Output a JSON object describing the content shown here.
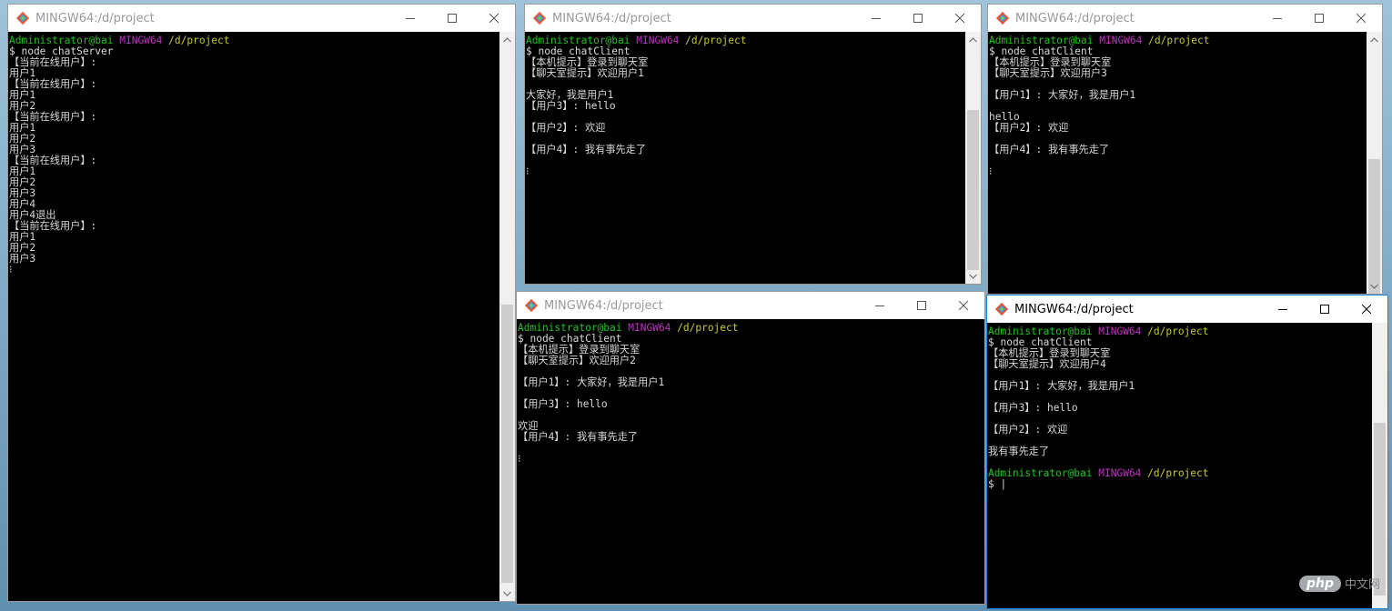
{
  "windows": {
    "server": {
      "title": "MINGW64:/d/project",
      "lines": [
        {
          "segments": [
            {
              "text": "Administrator@bai ",
              "c": "g"
            },
            {
              "text": "MINGW64 ",
              "c": "m"
            },
            {
              "text": "/d/project",
              "c": "y"
            }
          ]
        },
        {
          "text": "$ node chatServer"
        },
        {
          "text": "【当前在线用户】:"
        },
        {
          "text": "用户1"
        },
        {
          "text": "【当前在线用户】:"
        },
        {
          "text": "用户1"
        },
        {
          "text": "用户2"
        },
        {
          "text": "【当前在线用户】:"
        },
        {
          "text": "用户1"
        },
        {
          "text": "用户2"
        },
        {
          "text": "用户3"
        },
        {
          "text": "【当前在线用户】:"
        },
        {
          "text": "用户1"
        },
        {
          "text": "用户2"
        },
        {
          "text": "用户3"
        },
        {
          "text": "用户4"
        },
        {
          "text": "用户4退出"
        },
        {
          "text": "【当前在线用户】:"
        },
        {
          "text": "用户1"
        },
        {
          "text": "用户2"
        },
        {
          "text": "用户3"
        },
        {
          "text": "⁝"
        }
      ]
    },
    "client1": {
      "title": "MINGW64:/d/project",
      "lines": [
        {
          "segments": [
            {
              "text": "Administrator@bai ",
              "c": "g"
            },
            {
              "text": "MINGW64 ",
              "c": "m"
            },
            {
              "text": "/d/project",
              "c": "y"
            }
          ]
        },
        {
          "text": "$ node chatClient"
        },
        {
          "text": "【本机提示】登录到聊天室"
        },
        {
          "text": "【聊天室提示】欢迎用户1"
        },
        {
          "text": ""
        },
        {
          "text": "大家好，我是用户1"
        },
        {
          "text": "【用户3】: hello"
        },
        {
          "text": ""
        },
        {
          "text": "【用户2】: 欢迎"
        },
        {
          "text": ""
        },
        {
          "text": "【用户4】: 我有事先走了"
        },
        {
          "text": ""
        },
        {
          "text": "⁝"
        }
      ]
    },
    "client3": {
      "title": "MINGW64:/d/project",
      "lines": [
        {
          "segments": [
            {
              "text": "Administrator@bai ",
              "c": "g"
            },
            {
              "text": "MINGW64 ",
              "c": "m"
            },
            {
              "text": "/d/project",
              "c": "y"
            }
          ]
        },
        {
          "text": "$ node chatClient"
        },
        {
          "text": "【本机提示】登录到聊天室"
        },
        {
          "text": "【聊天室提示】欢迎用户3"
        },
        {
          "text": ""
        },
        {
          "text": "【用户1】: 大家好，我是用户1"
        },
        {
          "text": ""
        },
        {
          "text": "hello"
        },
        {
          "text": "【用户2】: 欢迎"
        },
        {
          "text": ""
        },
        {
          "text": "【用户4】: 我有事先走了"
        },
        {
          "text": ""
        },
        {
          "text": "⁝"
        }
      ]
    },
    "client2": {
      "title": "MINGW64:/d/project",
      "lines": [
        {
          "segments": [
            {
              "text": "Administrator@bai ",
              "c": "g"
            },
            {
              "text": "MINGW64 ",
              "c": "m"
            },
            {
              "text": "/d/project",
              "c": "y"
            }
          ]
        },
        {
          "text": "$ node chatClient"
        },
        {
          "text": "【本机提示】登录到聊天室"
        },
        {
          "text": "【聊天室提示】欢迎用户2"
        },
        {
          "text": ""
        },
        {
          "text": "【用户1】: 大家好，我是用户1"
        },
        {
          "text": ""
        },
        {
          "text": "【用户3】: hello"
        },
        {
          "text": ""
        },
        {
          "text": "欢迎"
        },
        {
          "text": "【用户4】: 我有事先走了"
        },
        {
          "text": ""
        },
        {
          "text": "⁝"
        }
      ]
    },
    "client4": {
      "title": "MINGW64:/d/project",
      "lines": [
        {
          "segments": [
            {
              "text": "Administrator@bai ",
              "c": "g"
            },
            {
              "text": "MINGW64 ",
              "c": "m"
            },
            {
              "text": "/d/project",
              "c": "y"
            }
          ]
        },
        {
          "text": "$ node chatClient"
        },
        {
          "text": "【本机提示】登录到聊天室"
        },
        {
          "text": "【聊天室提示】欢迎用户4"
        },
        {
          "text": ""
        },
        {
          "text": "【用户1】: 大家好，我是用户1"
        },
        {
          "text": ""
        },
        {
          "text": "【用户3】: hello"
        },
        {
          "text": ""
        },
        {
          "text": "【用户2】: 欢迎"
        },
        {
          "text": ""
        },
        {
          "text": "我有事先走了"
        },
        {
          "text": ""
        },
        {
          "segments": [
            {
              "text": "Administrator@bai ",
              "c": "g"
            },
            {
              "text": "MINGW64 ",
              "c": "m"
            },
            {
              "text": "/d/project",
              "c": "y"
            }
          ]
        },
        {
          "text": "$ |"
        }
      ]
    }
  },
  "controls": {
    "minimize": "minimize-icon",
    "maximize": "maximize-icon",
    "close": "close-icon"
  },
  "watermark": {
    "pill": "php",
    "text": "中文网"
  },
  "colors": {
    "prompt_user": "#1fc41f",
    "prompt_host": "#c030c0",
    "prompt_path": "#c8c830",
    "active_border": "#1883d7"
  }
}
